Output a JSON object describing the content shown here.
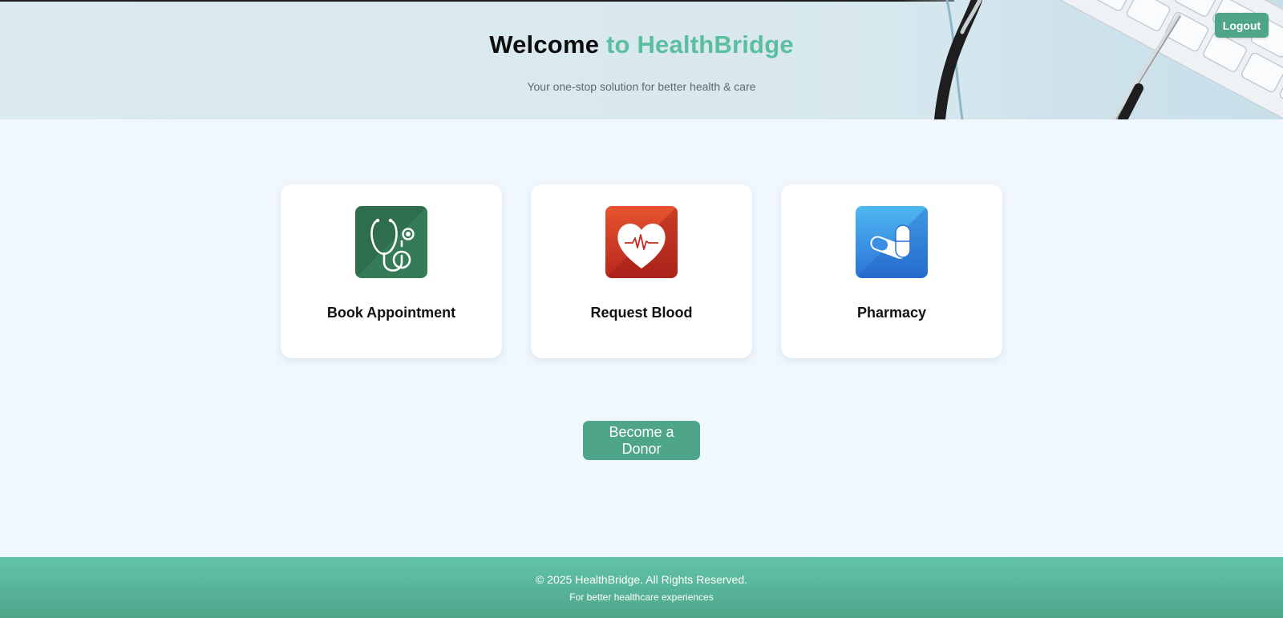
{
  "header": {
    "title_part1": "Welcome",
    "title_part2": "to HealthBridge",
    "subtitle": "Your one-stop solution for better health & care",
    "logout_label": "Logout",
    "image_icon": "keyboard-stethoscope-image"
  },
  "services": [
    {
      "label": "Book Appointment",
      "icon": "stethoscope-icon"
    },
    {
      "label": "Request Blood",
      "icon": "heart-pulse-icon"
    },
    {
      "label": "Pharmacy",
      "icon": "pill-capsule-icon"
    }
  ],
  "donor_button": {
    "label": "Become a Donor"
  },
  "footer": {
    "copyright": "© 2025 HealthBridge. All Rights Reserved.",
    "tagline": "For better healthcare experiences"
  },
  "colors": {
    "accent": "#4ea58a",
    "title_accent": "#5bbf9f",
    "page_background": "#f0f7fd",
    "footer_gradient_top": "#62c4a7",
    "appointment_icon_bg": "#2f6e4c",
    "blood_icon_bg": "#d2402a",
    "pharmacy_icon_bg": "#2f86e0"
  }
}
